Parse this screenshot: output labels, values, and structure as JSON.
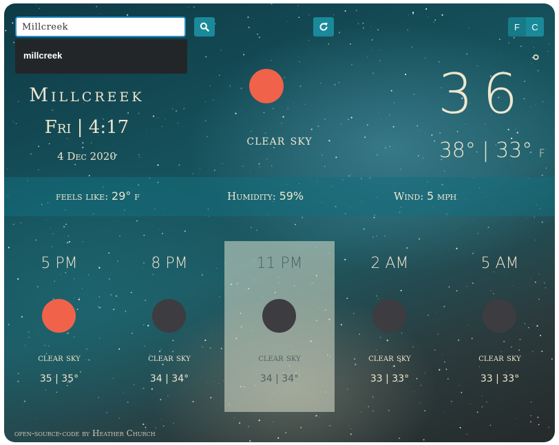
{
  "search": {
    "value": "Millcreek",
    "suggestion": "millcreek",
    "icon": "search-icon"
  },
  "toolbar": {
    "refresh_icon": "refresh-icon",
    "unit_f": "F",
    "unit_c": "C"
  },
  "current": {
    "city": "Millcreek",
    "day_time": "Fri | 4:17",
    "date": "4 Dec 2020",
    "condition": "clear sky",
    "temp": "36",
    "degree": "°",
    "hilo": "38° | 33°",
    "hilo_unit": "F"
  },
  "stats": {
    "feels_label": "feels like:",
    "feels_value": "29°",
    "feels_unit": "f",
    "humidity_label": "Humidity:",
    "humidity_value": "59%",
    "wind_label": "Wind:",
    "wind_value": "5",
    "wind_unit": "mph"
  },
  "forecast": [
    {
      "time": "5 PM",
      "condition": "clear sky",
      "temps": "35 | 35°"
    },
    {
      "time": "8 PM",
      "condition": "clear sky",
      "temps": "34 | 34°"
    },
    {
      "time": "11 PM",
      "condition": "clear sky",
      "temps": "34 | 34°"
    },
    {
      "time": "2 AM",
      "condition": "clear sky",
      "temps": "33 | 33°"
    },
    {
      "time": "5 AM",
      "condition": "clear sky",
      "temps": "33 | 33°"
    }
  ],
  "footer": {
    "text": "open-source code by Heather Church"
  },
  "colors": {
    "accent": "#1a8a9a",
    "sun": "#f0634a",
    "moon": "#3d3c41",
    "text": "#efe6cf"
  }
}
